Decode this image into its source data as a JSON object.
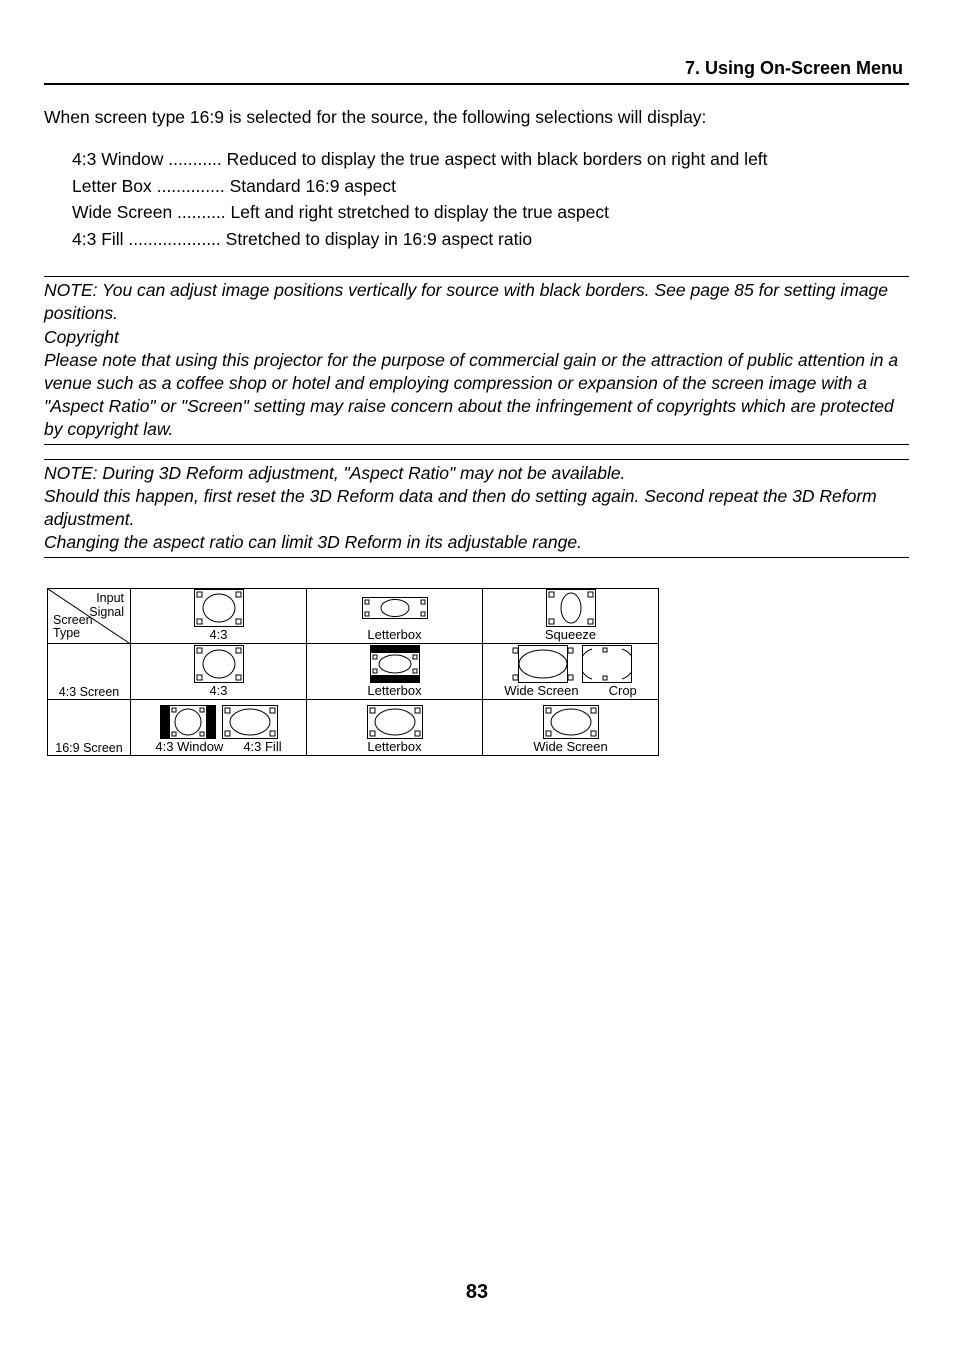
{
  "header": {
    "chapter": "7. Using On-Screen Menu"
  },
  "intro": "When screen type 16:9 is selected for the source, the following selections will display:",
  "definitions": [
    {
      "term": "4:3 Window",
      "dots": " ........... ",
      "desc": "Reduced to display the true aspect with black borders on right and left"
    },
    {
      "term": "Letter Box",
      "dots": " .............. ",
      "desc": "Standard 16:9 aspect"
    },
    {
      "term": "Wide Screen",
      "dots": " .......... ",
      "desc": "Left and right stretched to display the true aspect"
    },
    {
      "term": "4:3 Fill",
      "dots": " ................... ",
      "desc": "Stretched to display in 16:9 aspect ratio"
    }
  ],
  "note1": {
    "line1": "NOTE: You can adjust image positions vertically for source with black borders. See page 85 for setting image positions.",
    "line2": "Copyright",
    "line3": "Please note that using this projector for the purpose of commercial gain or the attraction of public attention in a venue such as a coffee shop or hotel and employing compression or expansion of the screen image with a \"Aspect Ratio\" or \"Screen\" setting may raise concern about the infringement of copyrights which are protected by copyright law."
  },
  "note2": {
    "line1": "NOTE: During 3D Reform adjustment, \"Aspect Ratio\" may not be available.",
    "line2": "Should this happen, first reset the 3D Reform data and then do setting again. Second repeat the 3D Reform adjustment.",
    "line3": "Changing the aspect ratio can limit 3D Reform in its adjustable range."
  },
  "table": {
    "corner": {
      "top": "Input\nSignal",
      "bottom": "Screen\nType"
    },
    "col_headers": [
      "4:3",
      "Letterbox",
      "Squeeze"
    ],
    "rows": [
      {
        "label": "4:3 Screen",
        "cells": [
          {
            "labels": [
              "4:3"
            ]
          },
          {
            "labels": [
              "Letterbox"
            ]
          },
          {
            "labels": [
              "Wide Screen",
              "Crop"
            ]
          }
        ]
      },
      {
        "label": "16:9 Screen",
        "cells": [
          {
            "labels": [
              "4:3 Window",
              "4:3 Fill"
            ]
          },
          {
            "labels": [
              "Letterbox"
            ]
          },
          {
            "labels": [
              "Wide Screen"
            ]
          }
        ]
      }
    ]
  },
  "page_number": "83"
}
